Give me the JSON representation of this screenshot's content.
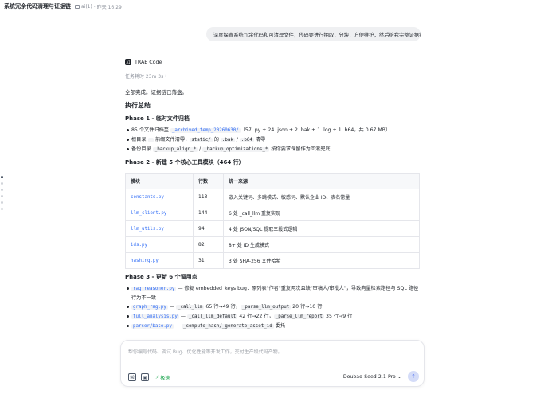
{
  "header": {
    "title": "系统冗余代码清理与证据链",
    "folder": "ai(1)",
    "time": "· 昨天 16:29"
  },
  "user_message": "深度探查系统冗余代码和可清理文件，代码要进行抽取，分块，方便维护，然后给我完整证据链",
  "agent": {
    "logo_text": "AI",
    "name": "TRAE Code",
    "duration": "任务耗时 23m 3s"
  },
  "result": {
    "intro": "全部完成。证据链已落盘。",
    "summary_title": "执行总结",
    "phase1": {
      "title": "Phase 1 - 临时文件归档",
      "item1_prefix": "85 个文件归档至 ",
      "item1_code": "_archived_temp_20260630/",
      "item1_suffix": "（57 .py + 24 .json + 2 .bak + 1 .log + 1 .b64，共 0.67 MB）",
      "item2_prefix": "根目录 ",
      "item2_code1": "_",
      "item2_mid": " 前缀文件清零，",
      "item2_code2": "static/",
      "item2_mid2": " 的 ",
      "item2_code3": ".bak",
      "item2_sep": " / ",
      "item2_code4": ".b64",
      "item2_suffix": " 清零",
      "item3_prefix": "备份目录 ",
      "item3_code1": "_backup_align_*",
      "item3_sep": " / ",
      "item3_code2": "_backup_optimizations_*",
      "item3_suffix": " 按你要求保留作为回滚兜底"
    },
    "phase2": {
      "title": "Phase 2 - 新建 5 个核心工具模块（464 行）",
      "headers": [
        "模块",
        "行数",
        "统一来源"
      ],
      "rows": [
        {
          "file": "constants.py",
          "lines": "113",
          "source": "嵌入关键词、多跳模式、敏感词、默认企业 ID、表名常量"
        },
        {
          "file": "llm_client.py",
          "lines": "144",
          "source": "6 处 _call_llm 重复实现"
        },
        {
          "file": "llm_utils.py",
          "lines": "94",
          "source": "4 处 JSON/SQL 提取三段式逻辑"
        },
        {
          "file": "ids.py",
          "lines": "82",
          "source": "8+ 处 ID 生成模式"
        },
        {
          "file": "hashing.py",
          "lines": "31",
          "source": "3 处 SHA-256 文件哈希"
        }
      ]
    },
    "phase3": {
      "title": "Phase 3 - 更新 6 个调用点",
      "item1_code": "rag_reasoner.py",
      "item1_text": " — 修复 embedded_keys bug：原列表\"作者\"重复两次且缺\"审稿人/审批人\"，导致向量检索路径与 SQL 路径行为不一致",
      "item2_code": "graph_rag.py",
      "item2_dash": " — ",
      "item2_mono1": "_call_llm",
      "item2_t1": " 65 行→49 行，",
      "item2_mono2": "_parse_llm_output",
      "item2_t2": " 20 行→10 行",
      "item3_code": "full_analysis.py",
      "item3_dash": " — ",
      "item3_mono1": "_call_llm_default",
      "item3_t1": " 42 行→22 行，",
      "item3_mono2": "_parse_llm_report",
      "item3_t2": " 35 行→9 行",
      "item4_code": "parser/base.py",
      "item4_dash": " — ",
      "item4_mono": "_compute_hash/_generate_asset_id",
      "item4_t": " 委托"
    }
  },
  "composer": {
    "placeholder": "帮你编写代码、调试 Bug、优化性能等开发工作，交付生产级代码产物。",
    "speed_label": "极速",
    "model": "Doubao-Seed-2.1-Pro",
    "send_icon": "send-icon"
  },
  "colors": {
    "link": "#2f6cf6",
    "speed": "#16a34a",
    "send_bg": "#d4dcf8"
  }
}
